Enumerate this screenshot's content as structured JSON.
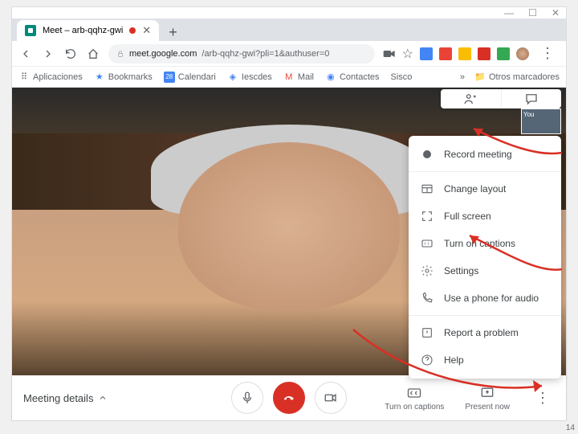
{
  "window": {
    "min": "—",
    "max": "☐",
    "close": "✕"
  },
  "tab": {
    "title": "Meet – arb-qqhz-gwi"
  },
  "url": {
    "host": "meet.google.com",
    "path": "/arb-qqhz-gwi?pli=1&authuser=0"
  },
  "bookmarks": {
    "apps": "Aplicaciones",
    "items": [
      "Bookmarks",
      "Calendari",
      "Iescdes",
      "Mail",
      "Contactes",
      "Sisco"
    ],
    "overflow": "»",
    "other": "Otros marcadores"
  },
  "pip": {
    "label": "You"
  },
  "menu": {
    "record": "Record meeting",
    "layout": "Change layout",
    "fullscreen": "Full screen",
    "captions": "Turn on captions",
    "settings": "Settings",
    "phone": "Use a phone for audio",
    "report": "Report a problem",
    "help": "Help"
  },
  "bottom": {
    "details": "Meeting details",
    "captions": "Turn on captions",
    "present": "Present now"
  },
  "pagenum": "14"
}
